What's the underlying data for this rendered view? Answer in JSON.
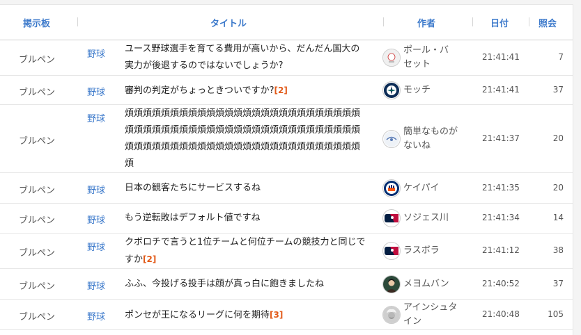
{
  "header": {
    "board": "掲示板",
    "title": "タイトル",
    "author": "作者",
    "date": "日付",
    "views": "照会"
  },
  "rows": [
    {
      "board": "ブルペン",
      "category": "野球",
      "title_lines": [
        "ユース野球選手を育てる費用が高いから、だんだん国大の",
        "実力が後退するのではないでしょうか?"
      ],
      "comments": "",
      "avatar": "baseball-icon",
      "author_lines": [
        "ポール・バ",
        "セット"
      ],
      "date": "21:41:41",
      "views": "7"
    },
    {
      "board": "ブルペン",
      "category": "野球",
      "title_lines": [
        "審判の判定がちょっときついですか?"
      ],
      "comments": "[2]",
      "avatar": "mariners-logo-icon",
      "author_lines": [
        "モッチ"
      ],
      "date": "21:41:41",
      "views": "37"
    },
    {
      "board": "ブルペン",
      "category": "野球",
      "title_lines": [
        "煩煩煩煩煩煩煩煩煩煩煩煩煩煩煩煩煩煩煩煩煩煩煩煩煩煩",
        "煩煩煩煩煩煩煩煩煩煩煩煩煩煩煩煩煩煩煩煩煩煩煩煩煩煩",
        "煩煩煩煩煩煩煩煩煩煩煩煩煩煩煩煩煩煩煩煩煩煩煩煩煩煩",
        "煩"
      ],
      "comments": "",
      "avatar": "team-logo-icon",
      "author_lines": [
        "簡単なものが",
        "ないね"
      ],
      "date": "21:41:37",
      "views": "20"
    },
    {
      "board": "ブルペン",
      "category": "野球",
      "title_lines": [
        "日本の観客たちにサービスするね"
      ],
      "comments": "",
      "avatar": "mets-logo-icon",
      "author_lines": [
        "ケイパイ"
      ],
      "date": "21:41:35",
      "views": "20"
    },
    {
      "board": "ブルペン",
      "category": "野球",
      "title_lines": [
        "もう逆転敗はデフォルト値ですね"
      ],
      "comments": "",
      "avatar": "mlb-logo-icon",
      "author_lines": [
        "ソジェス川"
      ],
      "date": "21:41:34",
      "views": "14"
    },
    {
      "board": "ブルペン",
      "category": "野球",
      "title_lines": [
        "クボロチで言うと1位チームと何位チームの競技力と同じで",
        "すか"
      ],
      "comments": "[2]",
      "avatar": "mlb-logo-icon",
      "author_lines": [
        "ラスボラ"
      ],
      "date": "21:41:12",
      "views": "38"
    },
    {
      "board": "ブルペン",
      "category": "野球",
      "title_lines": [
        "ふふ、今投げる投手は顔が真っ白に飽きましたね"
      ],
      "comments": "",
      "avatar": "person-photo-icon",
      "author_lines": [
        "メヨムバン"
      ],
      "date": "21:40:52",
      "views": "37"
    },
    {
      "board": "ブルペン",
      "category": "野球",
      "title_lines": [
        "ポンセが王になるリーグに何を期待"
      ],
      "comments": "[3]",
      "avatar": "einstein-photo-icon",
      "author_lines": [
        "アインシュタ",
        "イン"
      ],
      "date": "21:40:48",
      "views": "105"
    }
  ]
}
